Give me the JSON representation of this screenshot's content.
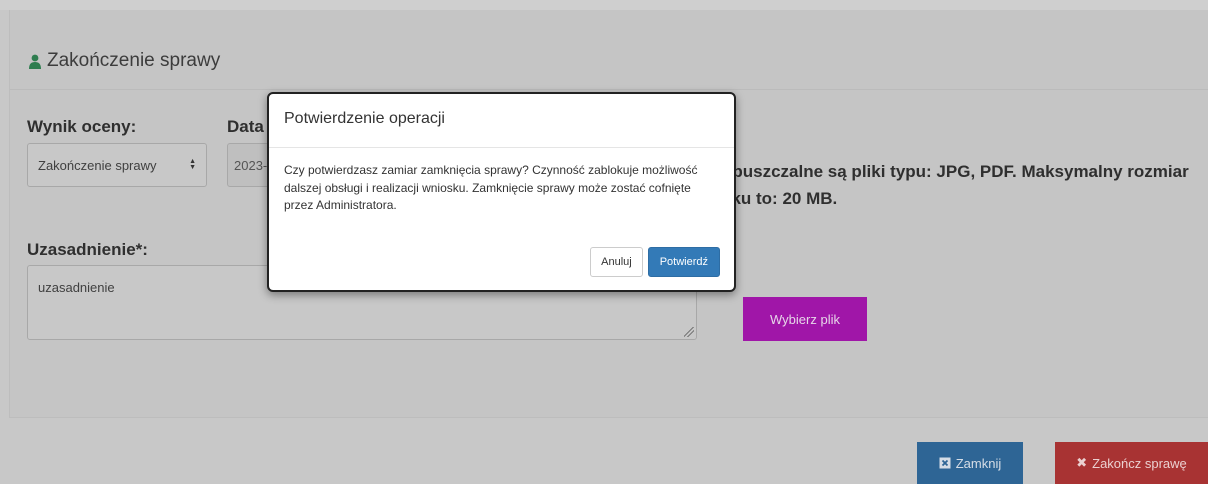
{
  "panel": {
    "title": "Zakończenie sprawy"
  },
  "form": {
    "result_label": "Wynik oceny:",
    "result_value": "Zakończenie sprawy",
    "date_label": "Data",
    "date_value": "2023-",
    "justification_label": "Uzasadnienie*:",
    "justification_value": "uzasadnienie",
    "file_info": "opuszczalne są pliki typu: JPG, PDF. Maksymalny rozmiar liku to: 20 MB.",
    "choose_file_label": "Wybierz plik"
  },
  "footer": {
    "close_label": "Zamknij",
    "finish_label": "Zakończ sprawę"
  },
  "modal": {
    "title": "Potwierdzenie operacji",
    "body": "Czy potwierdzasz zamiar zamknięcia sprawy? Czynność zablokuje możliwość dalszej obsługi i realizacji wniosku. Zamknięcie sprawy może zostać cofnięte przez Administratora.",
    "cancel_label": "Anuluj",
    "confirm_label": "Potwierdź"
  },
  "colors": {
    "overlay_bg": "#c8c8c8",
    "choose_file_bg": "#a016a8",
    "close_bg": "#2e6595",
    "finish_bg": "#a83333",
    "confirm_bg": "#337ab7",
    "user_icon": "#2e7d4f"
  },
  "icons": {
    "panel_title": "user-icon",
    "result_select": "sort-icon",
    "close_button": "close-square-icon",
    "finish_button": "times-icon"
  }
}
